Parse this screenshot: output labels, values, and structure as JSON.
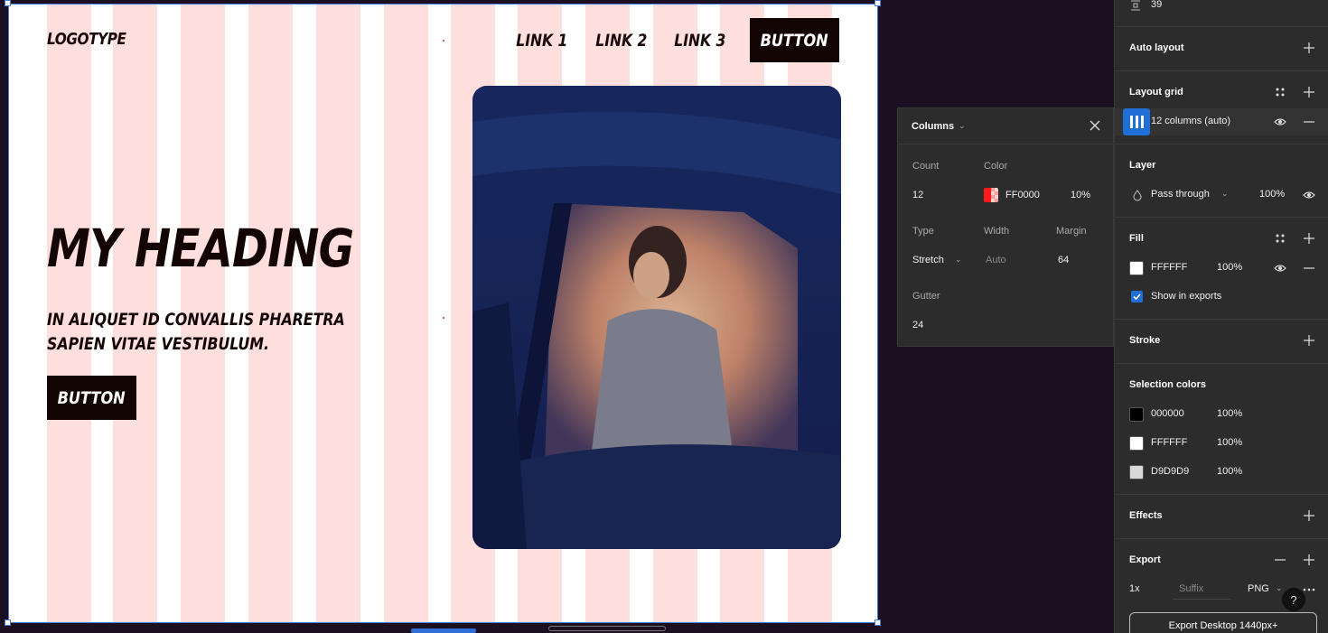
{
  "canvas": {
    "logo": "LOGOTYPE",
    "nav_links": [
      "LINK 1",
      "LINK 2",
      "LINK 3"
    ],
    "nav_button": "BUTTON",
    "heading": "MY HEADING",
    "subtext": "IN ALIQUET ID CONVALLIS PHARETRA SAPIEN VITAE VESTIBULUM.",
    "hero_button": "BUTTON",
    "grid_color": "#FF0000"
  },
  "columns_popup": {
    "title": "Columns",
    "count_label": "Count",
    "count_value": "12",
    "color_label": "Color",
    "color_value": "FF0000",
    "color_opacity": "10%",
    "type_label": "Type",
    "type_value": "Stretch",
    "width_label": "Width",
    "width_placeholder": "Auto",
    "margin_label": "Margin",
    "margin_value": "64",
    "gutter_label": "Gutter",
    "gutter_value": "24"
  },
  "panel": {
    "top_value": "39",
    "auto_layout": "Auto layout",
    "layout_grid": "Layout grid",
    "grid_item": "12 columns (auto)",
    "layer": "Layer",
    "blend_mode": "Pass through",
    "layer_opacity": "100%",
    "fill": "Fill",
    "fill_color": "FFFFFF",
    "fill_opacity": "100%",
    "show_in_exports": "Show in exports",
    "stroke": "Stroke",
    "selection_colors": "Selection colors",
    "sel_colors": [
      {
        "hex": "000000",
        "opacity": "100%",
        "swatch": "#000000"
      },
      {
        "hex": "FFFFFF",
        "opacity": "100%",
        "swatch": "#FFFFFF"
      },
      {
        "hex": "D9D9D9",
        "opacity": "100%",
        "swatch": "#D9D9D9"
      }
    ],
    "effects": "Effects",
    "export": "Export",
    "export_scale": "1x",
    "export_suffix_placeholder": "Suffix",
    "export_format": "PNG",
    "export_button": "Export Desktop 1440px+",
    "help": "?"
  }
}
